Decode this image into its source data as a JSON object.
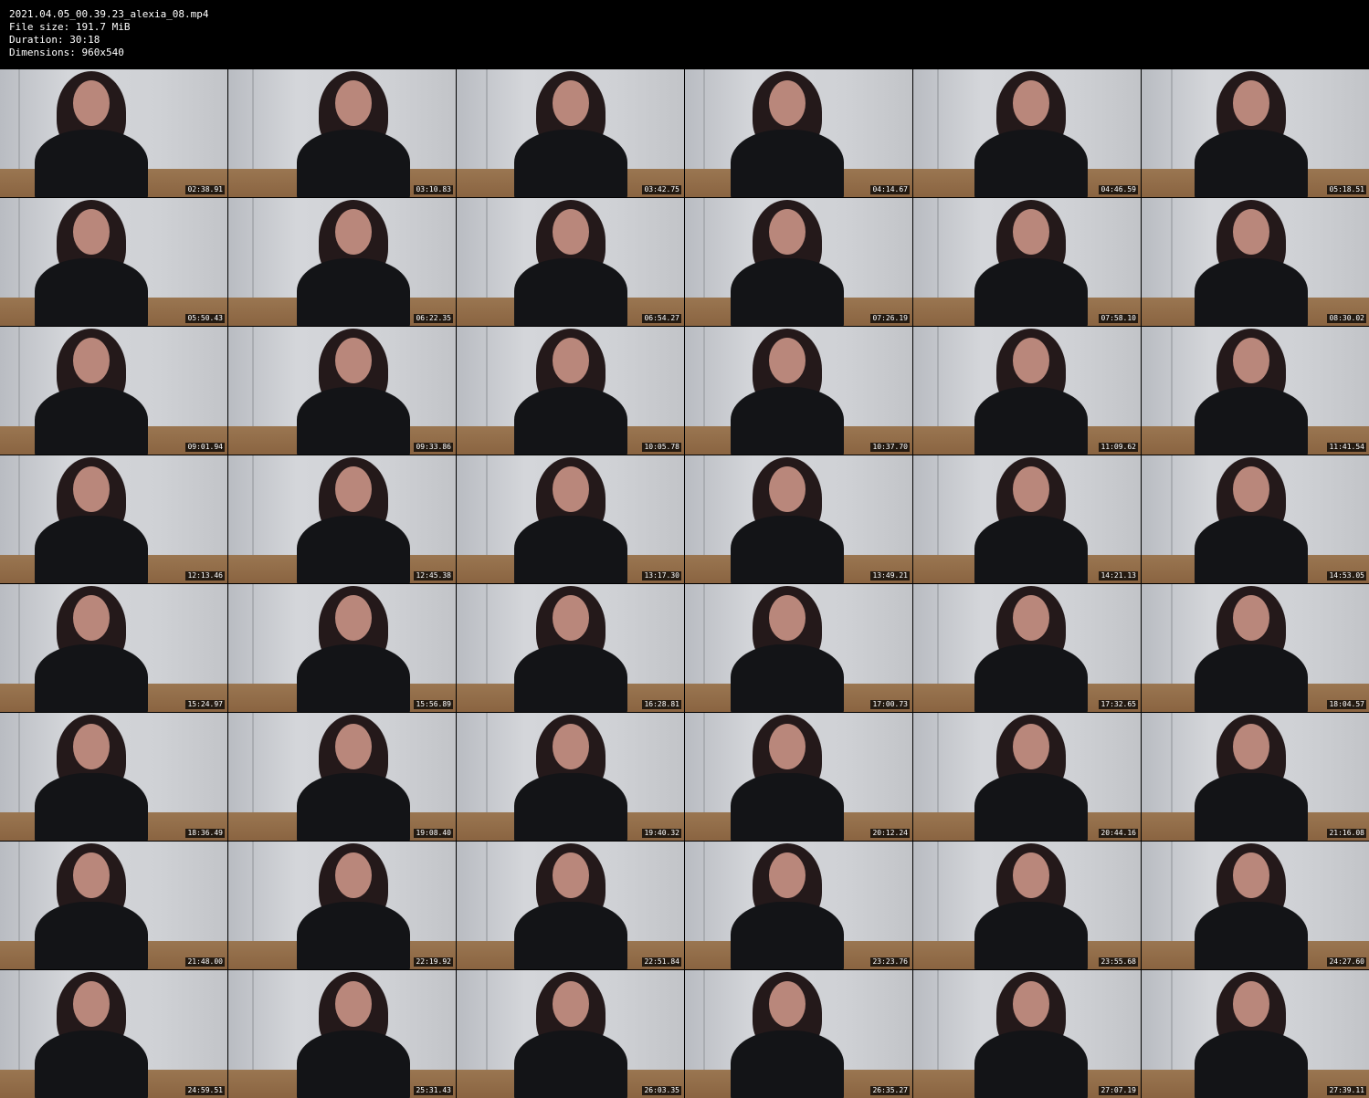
{
  "header": {
    "filename": "2021.04.05_00.39.23_alexia_08.mp4",
    "file_size": "File size: 191.7 MiB",
    "duration": "Duration: 30:18",
    "dimensions": "Dimensions: 960x540"
  },
  "thumbnails": [
    {
      "timestamp": "02:38.91"
    },
    {
      "timestamp": "03:10.83"
    },
    {
      "timestamp": "03:42.75"
    },
    {
      "timestamp": "04:14.67"
    },
    {
      "timestamp": "04:46.59"
    },
    {
      "timestamp": "05:18.51"
    },
    {
      "timestamp": "05:50.43"
    },
    {
      "timestamp": "06:22.35"
    },
    {
      "timestamp": "06:54.27"
    },
    {
      "timestamp": "07:26.19"
    },
    {
      "timestamp": "07:58.10"
    },
    {
      "timestamp": "08:30.02"
    },
    {
      "timestamp": "09:01.94"
    },
    {
      "timestamp": "09:33.86"
    },
    {
      "timestamp": "10:05.78"
    },
    {
      "timestamp": "10:37.70"
    },
    {
      "timestamp": "11:09.62"
    },
    {
      "timestamp": "11:41.54"
    },
    {
      "timestamp": "12:13.46"
    },
    {
      "timestamp": "12:45.38"
    },
    {
      "timestamp": "13:17.30"
    },
    {
      "timestamp": "13:49.21"
    },
    {
      "timestamp": "14:21.13"
    },
    {
      "timestamp": "14:53.05"
    },
    {
      "timestamp": "15:24.97"
    },
    {
      "timestamp": "15:56.89"
    },
    {
      "timestamp": "16:28.81"
    },
    {
      "timestamp": "17:00.73"
    },
    {
      "timestamp": "17:32.65"
    },
    {
      "timestamp": "18:04.57"
    },
    {
      "timestamp": "18:36.49"
    },
    {
      "timestamp": "19:08.40"
    },
    {
      "timestamp": "19:40.32"
    },
    {
      "timestamp": "20:12.24"
    },
    {
      "timestamp": "20:44.16"
    },
    {
      "timestamp": "21:16.08"
    },
    {
      "timestamp": "21:48.00"
    },
    {
      "timestamp": "22:19.92"
    },
    {
      "timestamp": "22:51.84"
    },
    {
      "timestamp": "23:23.76"
    },
    {
      "timestamp": "23:55.68"
    },
    {
      "timestamp": "24:27.60"
    },
    {
      "timestamp": "24:59.51"
    },
    {
      "timestamp": "25:31.43"
    },
    {
      "timestamp": "26:03.35"
    },
    {
      "timestamp": "26:35.27"
    },
    {
      "timestamp": "27:07.19"
    },
    {
      "timestamp": "27:39.11"
    }
  ]
}
